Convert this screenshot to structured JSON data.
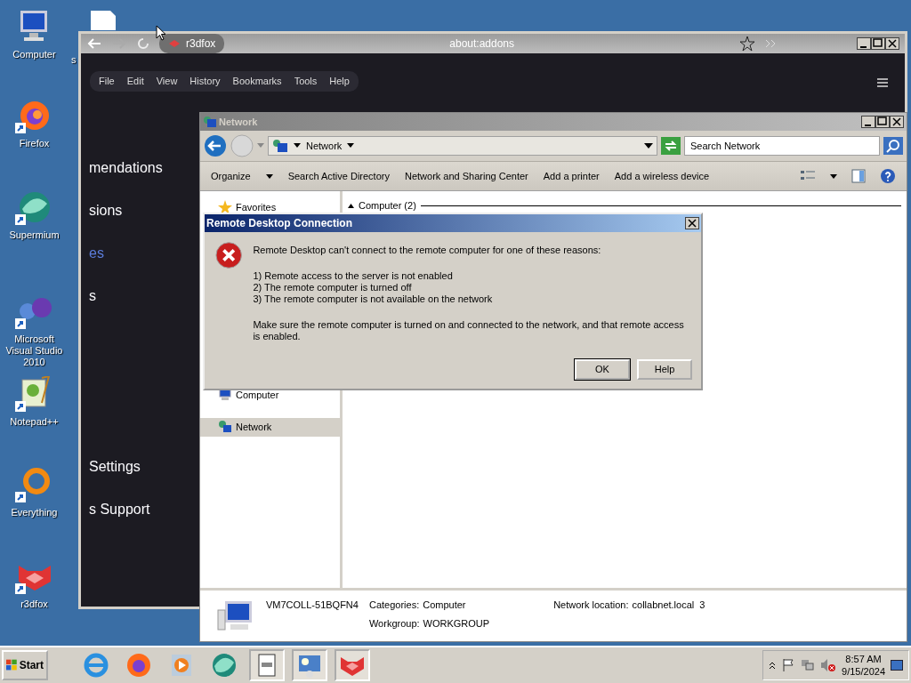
{
  "desktop_icons": [
    {
      "label": "Computer",
      "kind": "computer"
    },
    {
      "label": "s",
      "kind": "file"
    },
    {
      "label": "Firefox",
      "kind": "firefox"
    },
    {
      "label": "Supermium",
      "kind": "supermium"
    },
    {
      "label": "Microsoft Visual Studio 2010",
      "kind": "vs"
    },
    {
      "label": "Notepad++",
      "kind": "notepad"
    },
    {
      "label": "Everything",
      "kind": "everything"
    },
    {
      "label": "r3dfox",
      "kind": "fox"
    }
  ],
  "browser": {
    "tab_title": "r3dfox",
    "url": "about:addons",
    "menu": [
      "File",
      "Edit",
      "View",
      "History",
      "Bookmarks",
      "Tools",
      "Help"
    ],
    "sidebar_items": [
      {
        "label": "mendations",
        "selected": false
      },
      {
        "label": "sions",
        "selected": false
      },
      {
        "label": "es",
        "selected": true
      },
      {
        "label": "s",
        "selected": false
      },
      {
        "label": "Settings",
        "selected": false
      },
      {
        "label": "s Support",
        "selected": false
      }
    ]
  },
  "explorer": {
    "title": "Network",
    "address": "Network",
    "search": {
      "placeholder": "Search Network"
    },
    "toolbar": [
      "Organize",
      "Search Active Directory",
      "Network and Sharing Center",
      "Add a printer",
      "Add a wireless device"
    ],
    "nav_items": [
      {
        "label": "Favorites",
        "kind": "star",
        "selected": false
      },
      {
        "label": "Computer",
        "kind": "computer",
        "selected": false
      },
      {
        "label": "Network",
        "kind": "network",
        "selected": true
      }
    ],
    "group_header": "Computer (2)",
    "details": {
      "name": "VM7COLL-51BQFN4",
      "fields": [
        {
          "label": "Categories:",
          "value": "Computer"
        },
        {
          "label": "Workgroup:",
          "value": "WORKGROUP"
        },
        {
          "label": "Network location:",
          "value": "collabnet.local  3"
        }
      ]
    }
  },
  "dialog": {
    "title": "Remote Desktop Connection",
    "message": "Remote Desktop can't connect to the remote computer for one of these reasons:",
    "reasons": [
      "1) Remote access to the server is not enabled",
      "2) The remote computer is turned off",
      "3) The remote computer is not available on the network"
    ],
    "advice": "Make sure the remote computer is turned on and connected to the network, and that remote access is enabled.",
    "buttons": [
      {
        "label": "OK",
        "default": true
      },
      {
        "label": "Help",
        "default": false
      }
    ]
  },
  "taskbar": {
    "start": "Start",
    "time": "8:57 AM",
    "date": "9/15/2024"
  }
}
